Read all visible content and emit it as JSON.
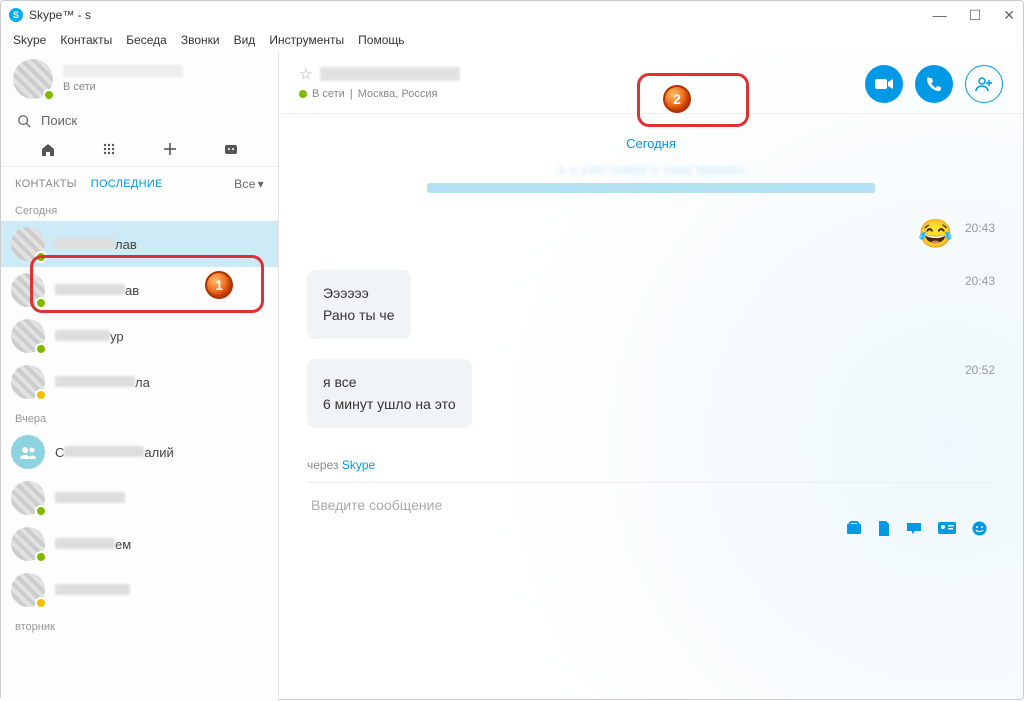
{
  "titlebar": {
    "title": "Skype™ - s"
  },
  "menu": [
    "Skype",
    "Контакты",
    "Беседа",
    "Звонки",
    "Вид",
    "Инструменты",
    "Помощь"
  ],
  "me": {
    "status": "В сети"
  },
  "search": {
    "placeholder": "Поиск"
  },
  "tabs": {
    "contacts": "КОНТАКТЫ",
    "recent": "ПОСЛЕДНИЕ",
    "filter": "Все"
  },
  "sections": {
    "today": "Сегодня",
    "yesterday": "Вчера",
    "tuesday": "вторник"
  },
  "contacts_today": [
    {
      "suffix": "лав",
      "status": "online",
      "selected": true
    },
    {
      "suffix": "ав",
      "status": "online"
    },
    {
      "suffix": "ур",
      "status": "online"
    },
    {
      "suffix": "ла",
      "status": "away"
    }
  ],
  "contacts_yesterday": [
    {
      "prefix": "С",
      "suffix": "алий",
      "group": true
    },
    {
      "suffix": "",
      "status": "online"
    },
    {
      "suffix": "ем",
      "status": "online"
    },
    {
      "suffix": "",
      "status": "away"
    }
  ],
  "chat_header": {
    "status_text": "В сети",
    "location": "Москва, Россия"
  },
  "chat": {
    "day": "Сегодня",
    "faded": "а я уже помру к тому времен",
    "rows": [
      {
        "type": "emoji",
        "time": "20:43"
      },
      {
        "type": "bubble",
        "lines": [
          "Ээээээ",
          "Рано ты че"
        ],
        "time": "20:43"
      },
      {
        "type": "bubble",
        "lines": [
          "я все",
          "6 минут ушло на это"
        ],
        "time": "20:52"
      }
    ],
    "via_prefix": "через ",
    "via_link": "Skype",
    "input_placeholder": "Введите сообщение"
  }
}
